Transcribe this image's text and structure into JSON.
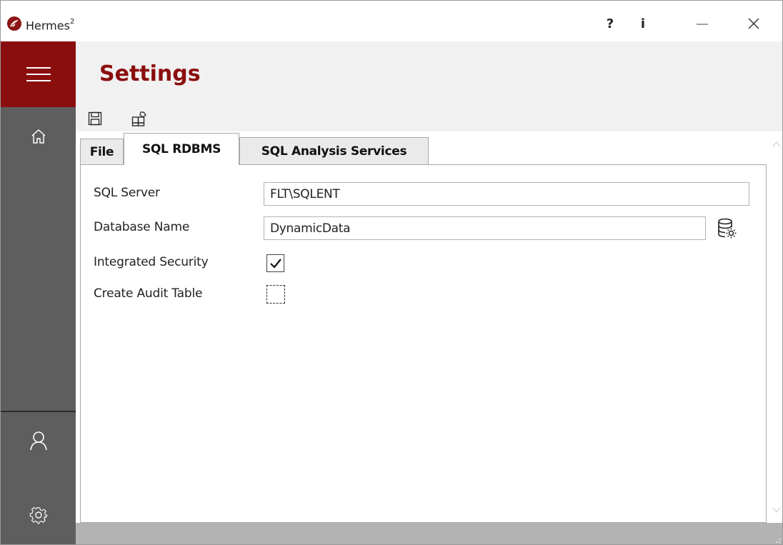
{
  "window": {
    "title": "Hermes",
    "title_superscript": "2",
    "help_label": "?",
    "info_label": "i",
    "minimize_icon": "minimize-icon",
    "close_icon": "close-icon"
  },
  "sidebar": {
    "items": [
      {
        "icon": "hamburger-menu-icon"
      },
      {
        "icon": "home-icon"
      },
      {
        "icon": "user-icon"
      },
      {
        "icon": "gear-icon"
      }
    ]
  },
  "header": {
    "title": "Settings"
  },
  "toolbar": {
    "items": [
      {
        "icon": "save-icon"
      },
      {
        "icon": "new-settings-icon"
      }
    ]
  },
  "tabs": [
    {
      "label": "File",
      "active": false
    },
    {
      "label": "SQL RDBMS",
      "active": true
    },
    {
      "label": "SQL Analysis Services",
      "active": false
    }
  ],
  "form": {
    "sql_server_label": "SQL Server",
    "sql_server_value": "FLT\\SQLENT",
    "database_name_label": "Database Name",
    "database_name_value": "DynamicData",
    "integrated_security_label": "Integrated Security",
    "integrated_security_checked": true,
    "create_audit_table_label": "Create Audit Table",
    "create_audit_table_checked": false,
    "database_button_icon": "database-settings-icon"
  },
  "colors": {
    "accent": "#8b0e0e",
    "sidebar": "#5e5e5e",
    "header_bg": "#f1f1f1",
    "statusbar": "#b3b3b3"
  }
}
